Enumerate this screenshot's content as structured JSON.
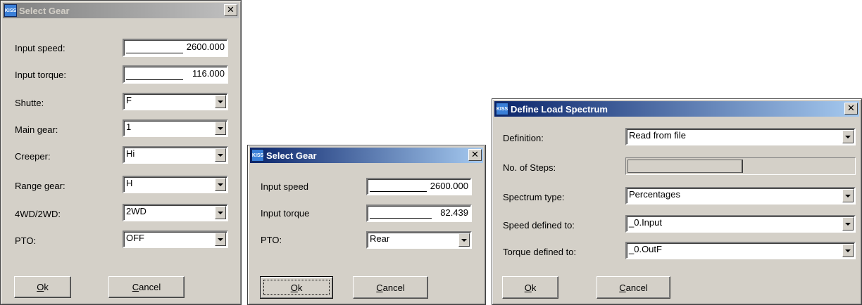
{
  "dialog1": {
    "title": "Select Gear",
    "close": "✕",
    "rows": [
      {
        "label": "Input speed:",
        "value": "2600.000"
      },
      {
        "label": "Input torque:",
        "value": "116.000"
      },
      {
        "label": "Shutte:",
        "value": "F"
      },
      {
        "label": "Main gear:",
        "value": "1"
      },
      {
        "label": "Creeper:",
        "value": "Hi"
      },
      {
        "label": "Range gear:",
        "value": "H"
      },
      {
        "label": "4WD/2WD:",
        "value": "2WD"
      },
      {
        "label": "PTO:",
        "value": "OFF"
      }
    ],
    "ok_mnemonic": "O",
    "ok_rest": "k",
    "cancel_mnemonic": "C",
    "cancel_rest": "ancel"
  },
  "dialog2": {
    "title": "Select Gear",
    "close": "✕",
    "rows": [
      {
        "label": "Input speed",
        "value": "2600.000"
      },
      {
        "label": "Input torque",
        "value": "82.439"
      },
      {
        "label": "PTO:",
        "value": "Rear"
      }
    ],
    "ok_mnemonic": "O",
    "ok_rest": "k",
    "cancel_mnemonic": "C",
    "cancel_rest": "ancel"
  },
  "dialog3": {
    "title": "Define Load Spectrum",
    "close": "✕",
    "rows": [
      {
        "label": "Definition:",
        "value": "Read from file"
      },
      {
        "label": "No. of Steps:",
        "value": ""
      },
      {
        "label": "Spectrum type:",
        "value": "Percentages"
      },
      {
        "label": "Speed defined to:",
        "value": "_0.Input"
      },
      {
        "label": "Torque defined to:",
        "value": "_0.OutF"
      }
    ],
    "ok_mnemonic": "O",
    "ok_rest": "k",
    "cancel_mnemonic": "C",
    "cancel_rest": "ancel"
  },
  "app_icon_text": "KISS"
}
